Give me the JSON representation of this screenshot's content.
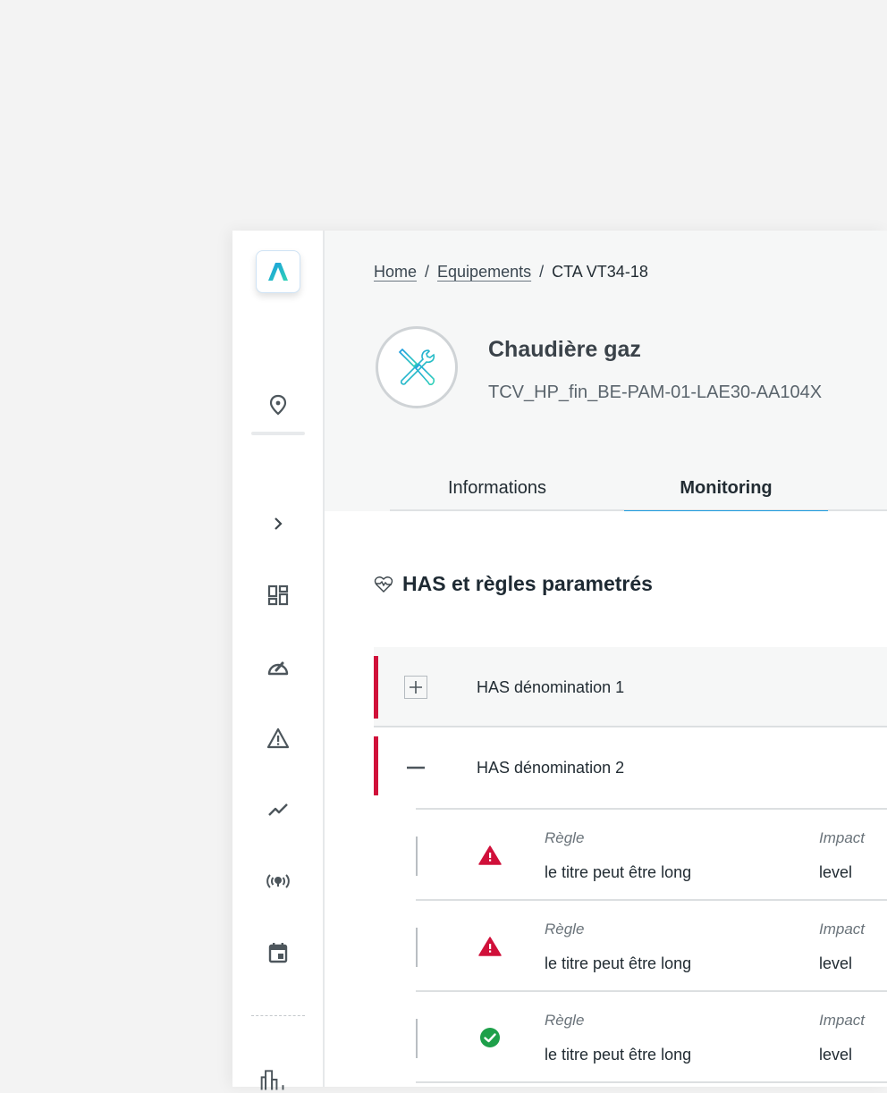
{
  "sidebar": {
    "logo": "app-logo",
    "items": [
      {
        "icon": "location-pin-icon",
        "label": "Localisation"
      },
      {
        "icon": "chevron-right-icon",
        "label": "Expand"
      },
      {
        "icon": "dashboard-icon",
        "label": "Dashboard"
      },
      {
        "icon": "gauge-icon",
        "label": "Performance"
      },
      {
        "icon": "warning-icon",
        "label": "Alertes"
      },
      {
        "icon": "trend-icon",
        "label": "Tendances"
      },
      {
        "icon": "broadcast-icon",
        "label": "Capteurs"
      },
      {
        "icon": "calendar-icon",
        "label": "Calendrier"
      },
      {
        "icon": "building-icon",
        "label": "Bâtiments"
      }
    ]
  },
  "breadcrumb": {
    "items": [
      {
        "label": "Home",
        "link": true
      },
      {
        "label": "Equipements",
        "link": true
      },
      {
        "label": "CTA VT34-18",
        "link": false
      }
    ],
    "separator": "/"
  },
  "equipment": {
    "icon": "tools-icon",
    "title": "Chaudière gaz",
    "code": "TCV_HP_fin_BE-PAM-01-LAE30-AA104X"
  },
  "tabs": [
    {
      "label": "Informations",
      "active": false
    },
    {
      "label": "Monitoring",
      "active": true
    }
  ],
  "section": {
    "icon": "heart-pulse-icon",
    "title": "HAS et règles parametrés"
  },
  "has_items": [
    {
      "label": "HAS dénomination 1",
      "expanded": false,
      "toggle": "+"
    },
    {
      "label": "HAS dénomination 2",
      "expanded": true,
      "toggle": "−"
    }
  ],
  "rules": [
    {
      "status": "error",
      "rule_label": "Règle",
      "rule_value": "le titre peut être long",
      "impact_label": "Impact",
      "impact_value": "level"
    },
    {
      "status": "error",
      "rule_label": "Règle",
      "rule_value": "le titre peut être long",
      "impact_label": "Impact",
      "impact_value": "level"
    },
    {
      "status": "ok",
      "rule_label": "Règle",
      "rule_value": "le titre peut être long",
      "impact_label": "Impact",
      "impact_value": "level"
    }
  ],
  "colors": {
    "accent": "#1a9be0",
    "danger": "#d0103a",
    "success": "#1ea04a",
    "logo_gradient_start": "#1a9be0",
    "logo_gradient_end": "#2fd3b5"
  }
}
